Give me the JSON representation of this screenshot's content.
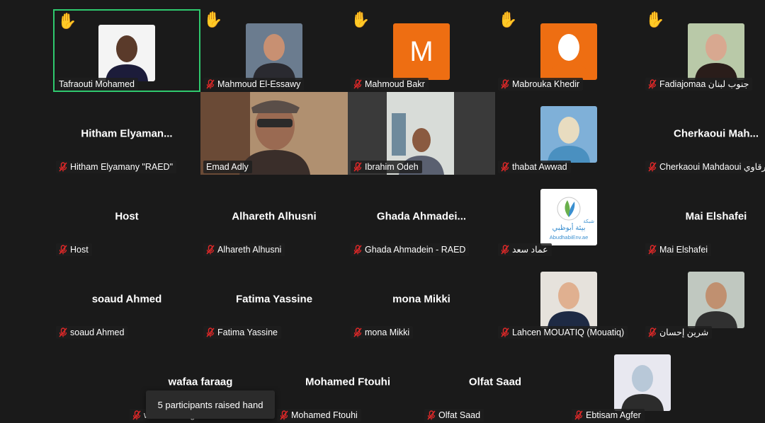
{
  "participants": [
    {
      "label": "Tafraouti Mohamed",
      "hand": true,
      "muted": false,
      "active": true,
      "avatar": "photo"
    },
    {
      "label": "Mahmoud El-Essawy",
      "hand": true,
      "muted": true,
      "avatar": "photo"
    },
    {
      "label": "Mahmoud Bakr",
      "hand": true,
      "muted": true,
      "avatar": "initial",
      "initial": "M",
      "avatar_color": "#ee6e12"
    },
    {
      "label": "Mabrouka Khedir",
      "hand": true,
      "muted": true,
      "avatar": "photo"
    },
    {
      "label": "Fadiajomaa جنوب لبنان",
      "hand": true,
      "muted": true,
      "avatar": "photo"
    },
    {
      "label": "Hitham Elyamany \"RAED\"",
      "display_name": "Hitham  Elyaman...",
      "muted": true,
      "avatar": "none"
    },
    {
      "label": "Emad Adly",
      "muted": false,
      "avatar": "video"
    },
    {
      "label": "Ibrahim Odeh",
      "muted": true,
      "avatar": "video"
    },
    {
      "label": "thabat Awwad",
      "muted": true,
      "avatar": "photo"
    },
    {
      "label": "Cherkaoui Mahdaoui شرقاوي",
      "display_name": "Cherkaoui  Mah...",
      "muted": true,
      "avatar": "none"
    },
    {
      "label": "Host",
      "display_name": "Host",
      "muted": true,
      "avatar": "none"
    },
    {
      "label": "Alhareth Alhusni",
      "display_name": "Alhareth Alhusni",
      "muted": true,
      "avatar": "none"
    },
    {
      "label": "Ghada Ahmadein - RAED",
      "display_name": "Ghada  Ahmadei...",
      "muted": true,
      "avatar": "none"
    },
    {
      "label": "عماد سعد",
      "muted": true,
      "avatar": "logo",
      "logo_text": "AbudhabiEnv.ae",
      "logo_arabic": "بيئة أبوظبي",
      "logo_small": "شبكة"
    },
    {
      "label": "Mai Elshafei",
      "display_name": "Mai Elshafei",
      "muted": true,
      "avatar": "none"
    },
    {
      "label": "soaud Ahmed",
      "display_name": "soaud Ahmed",
      "muted": true,
      "avatar": "none"
    },
    {
      "label": "Fatima Yassine",
      "display_name": "Fatima Yassine",
      "muted": true,
      "avatar": "none"
    },
    {
      "label": "mona Mikki",
      "display_name": "mona Mikki",
      "muted": true,
      "avatar": "none"
    },
    {
      "label": "Lahcen MOUATIQ (Mouatiq)",
      "muted": true,
      "avatar": "photo"
    },
    {
      "label": "شرين إحسان",
      "muted": true,
      "avatar": "photo"
    },
    {
      "label": "wafaa faraag",
      "display_name": "wafaa faraag",
      "muted": true,
      "avatar": "none"
    },
    {
      "label": "Mohamed Ftouhi",
      "display_name": "Mohamed Ftouhi",
      "muted": true,
      "avatar": "none"
    },
    {
      "label": "Olfat Saad",
      "display_name": "Olfat Saad",
      "muted": true,
      "avatar": "none"
    },
    {
      "label": "Ebtisam Agfer",
      "muted": true,
      "avatar": "photo"
    }
  ],
  "toast": {
    "text": "5 participants raised hand"
  },
  "colors": {
    "background": "#1a1a1a",
    "active_border": "#2fc96e",
    "muted_icon": "#e02828"
  },
  "icons": {
    "hand": "raised-hand-icon",
    "mic": "muted-mic-icon"
  }
}
